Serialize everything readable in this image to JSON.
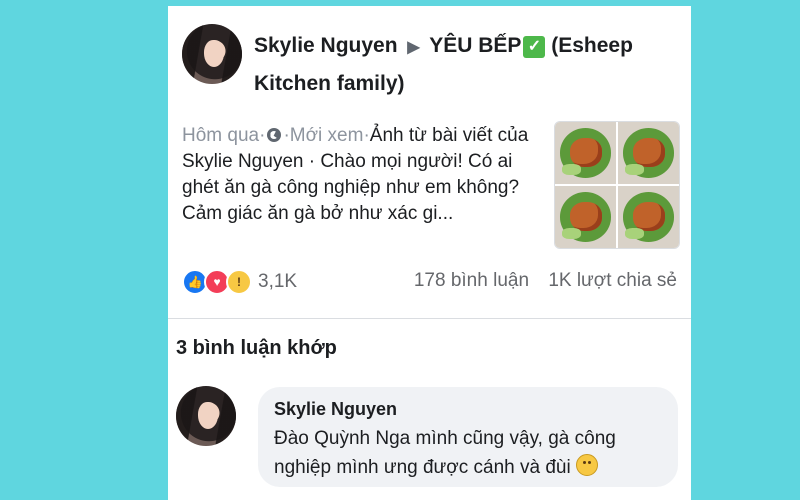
{
  "post": {
    "author": "Skylie Nguyen",
    "arrow": "▶",
    "group_name": "YÊU BẾP",
    "group_suffix": "(Esheep Kitchen family)",
    "check": "✓",
    "time": "Hôm qua",
    "sep": "·",
    "status": "Mới xem",
    "text": "Ảnh từ bài viết của Skylie Nguyen · Chào mọi người! Có ai ghét ăn gà công nghiệp như em không? Cảm giác ăn gà bở như xác gi...",
    "reactions_count": "3,1K",
    "comments": "178 bình luận",
    "shares": "1K lượt chia sẻ",
    "reaction_icons": [
      "like-icon",
      "love-icon",
      "wow-icon"
    ]
  },
  "matches": {
    "title": "3 bình luận khớp"
  },
  "comment": {
    "author": "Skylie Nguyen",
    "text": "Đào Quỳnh Nga  mình cũng vậy, gà công nghiệp mình ưng được cánh và đùi"
  },
  "colors": {
    "background": "#5fd6df",
    "like": "#1877f2",
    "love": "#f33e58",
    "wow": "#f7c843",
    "muted": "#65676b"
  }
}
